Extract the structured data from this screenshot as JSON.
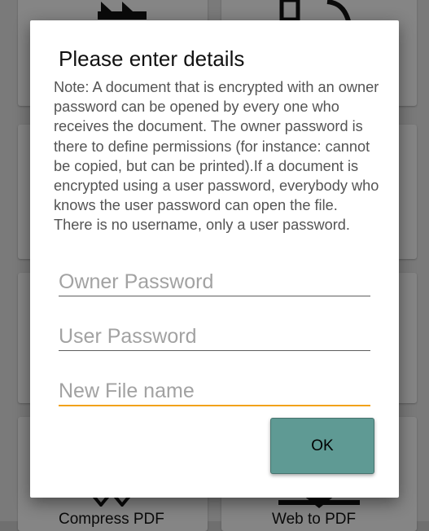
{
  "background": {
    "cards": [
      {
        "label": ""
      },
      {
        "label": ""
      },
      {
        "label": ""
      },
      {
        "label": ""
      },
      {
        "label": ""
      },
      {
        "label": ""
      },
      {
        "label": "Compress PDF"
      },
      {
        "label": "Web to PDF"
      }
    ],
    "icons": [
      "forward-arrows-icon",
      "rotate-document-icon",
      "compress-icon",
      "download-arrow-icon"
    ]
  },
  "dialog": {
    "title": "Please enter details",
    "note": "Note: A document that is encrypted with an owner password can be opened by every one who receives the document. The owner password is there to define permissions (for instance: cannot be copied, but can be printed).If a document is encrypted using a user password, everybody who knows the user password can open the file. There is no username, only a user password.",
    "fields": {
      "owner_password": {
        "placeholder": "Owner Password",
        "value": ""
      },
      "user_password": {
        "placeholder": "User Password",
        "value": ""
      },
      "file_name": {
        "placeholder": "New File name",
        "value": ""
      }
    },
    "ok_label": "OK"
  },
  "colors": {
    "accent_focus_underline": "#f1a21a",
    "ok_button": "#5f9a94",
    "scrim": "#7a7a7a"
  }
}
